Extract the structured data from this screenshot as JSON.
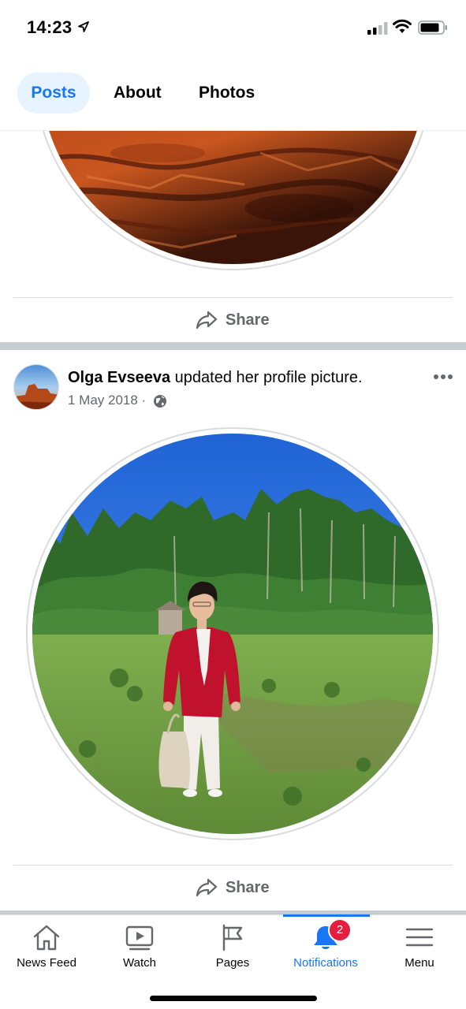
{
  "status_bar": {
    "time": "14:23",
    "icons": [
      "location-arrow-icon",
      "signal-icon",
      "wifi-icon",
      "battery-icon"
    ]
  },
  "tabs": [
    {
      "label": "Posts",
      "active": true
    },
    {
      "label": "About",
      "active": false
    },
    {
      "label": "Photos",
      "active": false
    }
  ],
  "post1": {
    "share_label": "Share"
  },
  "post2": {
    "author": "Olga  Evseeva",
    "action": " updated her profile picture.",
    "date": "1 May 2018 ·",
    "privacy_icon": "globe-icon",
    "share_label": "Share"
  },
  "bottom_nav": {
    "items": [
      {
        "label": "News Feed",
        "icon": "home-icon",
        "active": false
      },
      {
        "label": "Watch",
        "icon": "video-icon",
        "active": false
      },
      {
        "label": "Pages",
        "icon": "flag-icon",
        "active": false
      },
      {
        "label": "Notifications",
        "icon": "bell-icon",
        "active": true,
        "badge": "2"
      },
      {
        "label": "Menu",
        "icon": "hamburger-icon",
        "active": false
      }
    ]
  },
  "colors": {
    "accent": "#1877f2",
    "active_tab_bg": "#e7f3ff",
    "badge": "#e41e3f",
    "secondary_text": "#65676b"
  }
}
